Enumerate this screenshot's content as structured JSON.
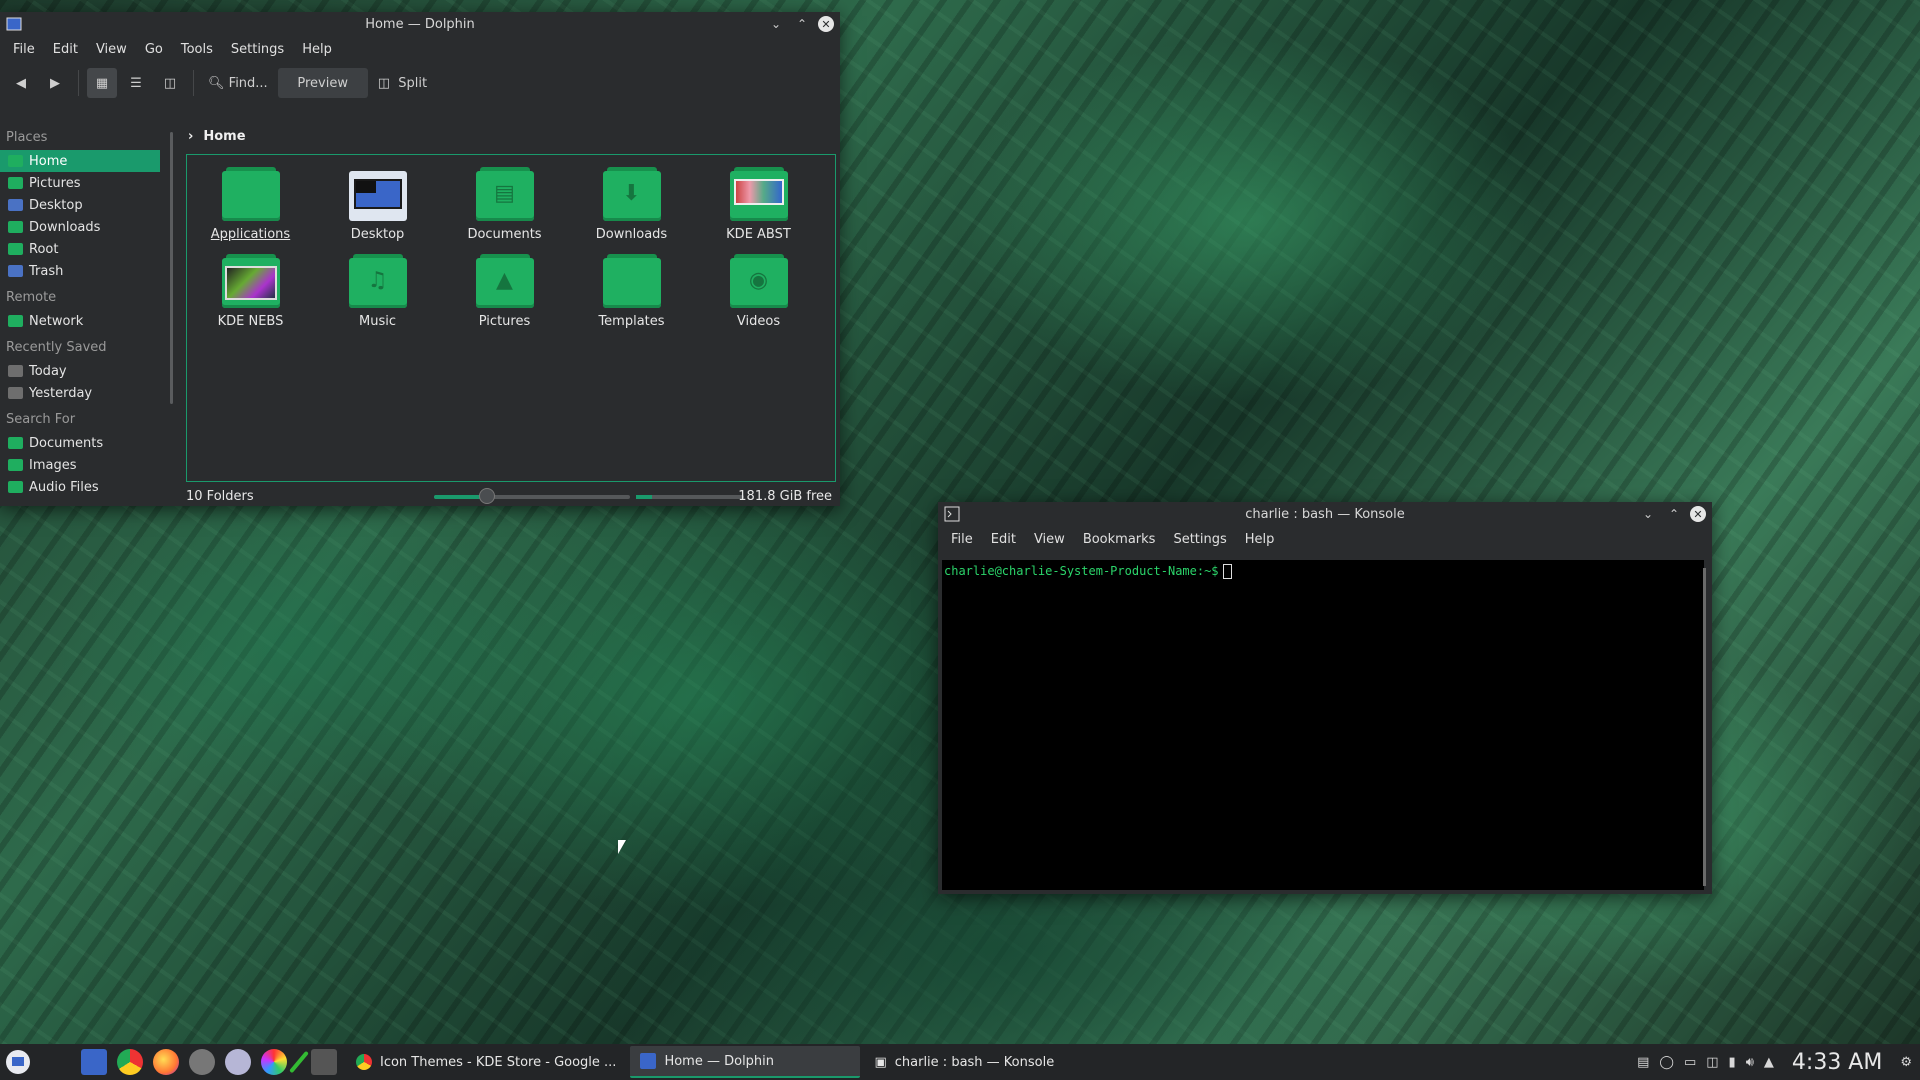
{
  "dolphin": {
    "title": "Home — Dolphin",
    "menu": [
      "File",
      "Edit",
      "View",
      "Go",
      "Tools",
      "Settings",
      "Help"
    ],
    "toolbar": {
      "find": "Find...",
      "preview": "Preview",
      "split": "Split"
    },
    "breadcrumb": "Home",
    "sidebar": {
      "places_head": "Places",
      "places": [
        "Home",
        "Pictures",
        "Desktop",
        "Downloads",
        "Root",
        "Trash"
      ],
      "remote_head": "Remote",
      "remote": [
        "Network"
      ],
      "recent_head": "Recently Saved",
      "recent": [
        "Today",
        "Yesterday"
      ],
      "search_head": "Search For",
      "search": [
        "Documents",
        "Images",
        "Audio Files"
      ]
    },
    "files": [
      "Applications",
      "Desktop",
      "Documents",
      "Downloads",
      "KDE ABST",
      "KDE NEBS",
      "Music",
      "Pictures",
      "Templates",
      "Videos"
    ],
    "status": {
      "count": "10 Folders",
      "free": "181.8 GiB free",
      "zoom_fraction": 0.27
    }
  },
  "konsole": {
    "title": "charlie : bash — Konsole",
    "menu": [
      "File",
      "Edit",
      "View",
      "Bookmarks",
      "Settings",
      "Help"
    ],
    "prompt": "charlie@charlie-System-Product-Name:~$"
  },
  "taskbar": {
    "tasks": [
      "Icon Themes - KDE Store - Google ...",
      "Home — Dolphin",
      "charlie : bash — Konsole"
    ],
    "clock": "4:33 AM"
  },
  "colors": {
    "accent": "#1a9a6c",
    "folder": "#1fb061"
  }
}
